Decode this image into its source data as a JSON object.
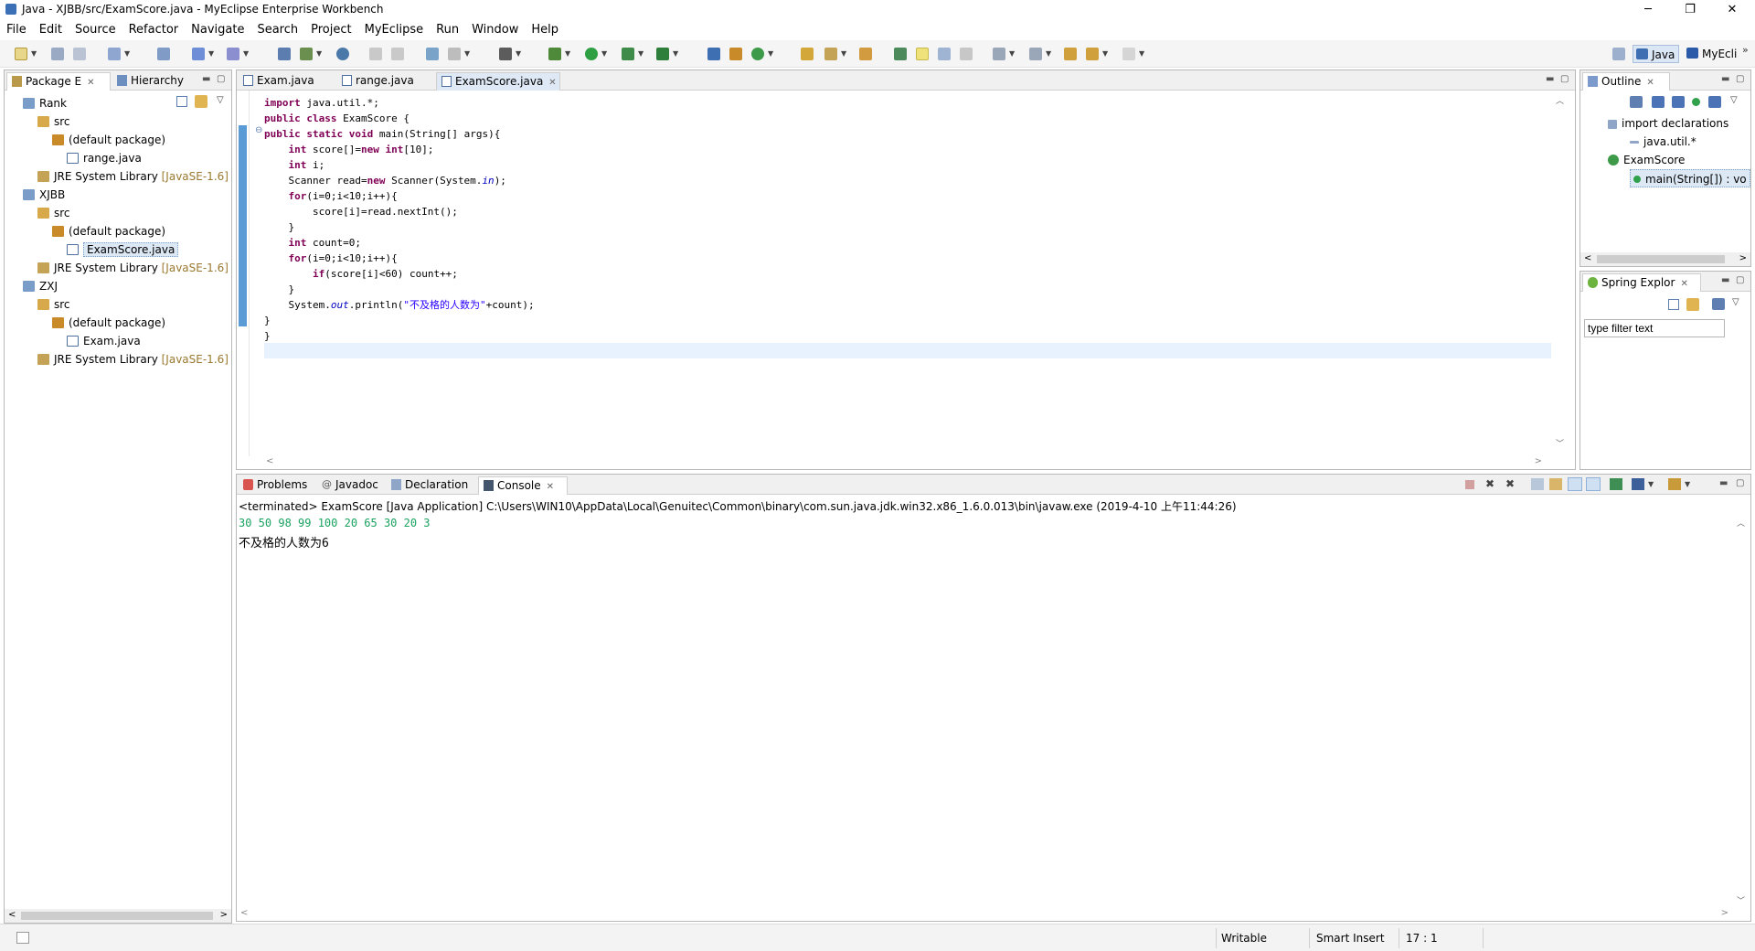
{
  "window": {
    "title": "Java - XJBB/src/ExamScore.java - MyEclipse Enterprise Workbench",
    "minimize": "─",
    "maximize": "❐",
    "close": "✕"
  },
  "menu": [
    "File",
    "Edit",
    "Source",
    "Refactor",
    "Navigate",
    "Search",
    "Project",
    "MyEclipse",
    "Run",
    "Window",
    "Help"
  ],
  "perspectives": [
    "Java",
    "MyEcli"
  ],
  "package_explorer": {
    "tabs": [
      "Package E",
      "Hierarchy"
    ],
    "tree": [
      {
        "label": "Rank",
        "icon": "project-icon"
      },
      {
        "label": "src",
        "icon": "source-folder-icon"
      },
      {
        "label": "(default package)",
        "icon": "package-icon"
      },
      {
        "label": "range.java",
        "icon": "java-file-icon"
      },
      {
        "label": "JRE System Library",
        "suffix": "[JavaSE-1.6]",
        "icon": "library-icon"
      },
      {
        "label": "XJBB",
        "icon": "project-icon"
      },
      {
        "label": "src",
        "icon": "source-folder-icon"
      },
      {
        "label": "(default package)",
        "icon": "package-icon"
      },
      {
        "label": "ExamScore.java",
        "icon": "java-file-icon",
        "selected": true
      },
      {
        "label": "JRE System Library",
        "suffix": "[JavaSE-1.6]",
        "icon": "library-icon"
      },
      {
        "label": "ZXJ",
        "icon": "project-icon"
      },
      {
        "label": "src",
        "icon": "source-folder-icon"
      },
      {
        "label": "(default package)",
        "icon": "package-icon"
      },
      {
        "label": "Exam.java",
        "icon": "java-file-icon"
      },
      {
        "label": "JRE System Library",
        "suffix": "[JavaSE-1.6]",
        "icon": "library-icon"
      }
    ]
  },
  "editor": {
    "tabs": [
      "Exam.java",
      "range.java",
      "ExamScore.java"
    ],
    "code": [
      [
        {
          "t": "import",
          "k": "kw"
        },
        {
          "t": " java.util.*;"
        }
      ],
      [
        {
          "t": "public",
          "k": "kw"
        },
        {
          "t": " "
        },
        {
          "t": "class",
          "k": "kw"
        },
        {
          "t": " ExamScore {"
        }
      ],
      [
        {
          "t": "public",
          "k": "kw"
        },
        {
          "t": " "
        },
        {
          "t": "static",
          "k": "kw"
        },
        {
          "t": " "
        },
        {
          "t": "void",
          "k": "kw"
        },
        {
          "t": " main(String[] args){"
        }
      ],
      [
        {
          "t": "    "
        },
        {
          "t": "int",
          "k": "kw"
        },
        {
          "t": " score[]="
        },
        {
          "t": "new",
          "k": "kw"
        },
        {
          "t": " "
        },
        {
          "t": "int",
          "k": "kw"
        },
        {
          "t": "[10];"
        }
      ],
      [
        {
          "t": "    "
        },
        {
          "t": "int",
          "k": "kw"
        },
        {
          "t": " i;"
        }
      ],
      [
        {
          "t": "    Scanner read="
        },
        {
          "t": "new",
          "k": "kw"
        },
        {
          "t": " Scanner(System."
        },
        {
          "t": "in",
          "k": "fld"
        },
        {
          "t": ");"
        }
      ],
      [
        {
          "t": "    "
        },
        {
          "t": "for",
          "k": "kw"
        },
        {
          "t": "(i=0;i<10;i++){"
        }
      ],
      [
        {
          "t": "        score[i]=read.nextInt();"
        }
      ],
      [
        {
          "t": "    }"
        }
      ],
      [
        {
          "t": "    "
        },
        {
          "t": "int",
          "k": "kw"
        },
        {
          "t": " count=0;"
        }
      ],
      [
        {
          "t": "    "
        },
        {
          "t": "for",
          "k": "kw"
        },
        {
          "t": "(i=0;i<10;i++){"
        }
      ],
      [
        {
          "t": "        "
        },
        {
          "t": "if",
          "k": "kw"
        },
        {
          "t": "(score[i]<60) count++;"
        }
      ],
      [
        {
          "t": "    }"
        }
      ],
      [
        {
          "t": "    System."
        },
        {
          "t": "out",
          "k": "fld"
        },
        {
          "t": ".println("
        },
        {
          "t": "\"不及格的人数为\"",
          "k": "str"
        },
        {
          "t": "+count);"
        }
      ],
      [
        {
          "t": "}"
        }
      ],
      [
        {
          "t": "}"
        }
      ]
    ]
  },
  "outline": {
    "tab": "Outline",
    "items": [
      "import declarations",
      "java.util.*",
      "ExamScore",
      "main(String[]) : vo"
    ]
  },
  "spring_explorer": {
    "tab": "Spring Explor",
    "filter_placeholder": "type filter text"
  },
  "bottom": {
    "tabs": [
      "Problems",
      "Javadoc",
      "Declaration",
      "Console"
    ],
    "console_header": "<terminated> ExamScore [Java Application] C:\\Users\\WIN10\\AppData\\Local\\Genuitec\\Common\\binary\\com.sun.java.jdk.win32.x86_1.6.0.013\\bin\\javaw.exe (2019-4-10 上午11:44:26)",
    "console_input": "30 50 98 99 100 20 65 30 20 3",
    "console_output": "不及格的人数为6"
  },
  "status": {
    "writable": "Writable",
    "insert_mode": "Smart Insert",
    "position": "17 : 1"
  }
}
